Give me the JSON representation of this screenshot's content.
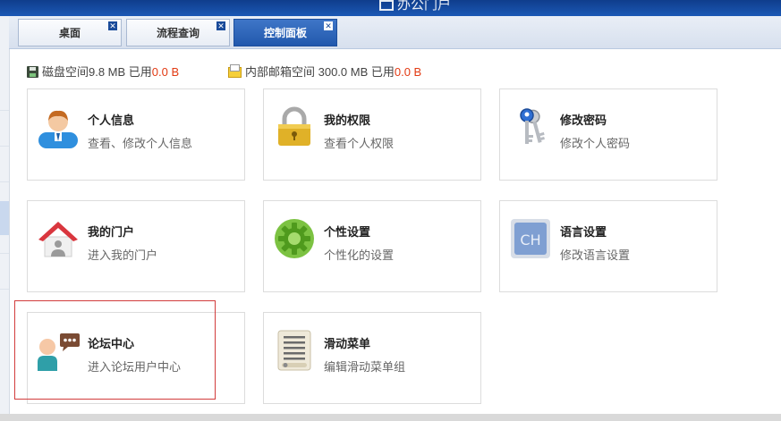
{
  "window": {
    "title": "办公门户"
  },
  "tabs": [
    {
      "label": "桌面",
      "close": "✕"
    },
    {
      "label": "流程查询",
      "close": "✕"
    },
    {
      "label": "控制面板",
      "close": "✕",
      "active": true
    }
  ],
  "status": {
    "disk_label": "磁盘空间9.8 MB 已用",
    "disk_used": "0.0 B",
    "mail_label": "内部邮箱空间 300.0 MB 已用",
    "mail_used": "0.0 B"
  },
  "cards": [
    {
      "title": "个人信息",
      "subtitle": "查看、修改个人信息",
      "icon": "person-icon"
    },
    {
      "title": "我的权限",
      "subtitle": "查看个人权限",
      "icon": "lock-icon"
    },
    {
      "title": "修改密码",
      "subtitle": "修改个人密码",
      "icon": "keys-icon"
    },
    {
      "title": "我的门户",
      "subtitle": "进入我的门户",
      "icon": "home-icon"
    },
    {
      "title": "个性设置",
      "subtitle": "个性化的设置",
      "icon": "gear-icon"
    },
    {
      "title": "语言设置",
      "subtitle": "修改语言设置",
      "icon": "language-icon",
      "icon_text": "CH"
    },
    {
      "title": "论坛中心",
      "subtitle": "进入论坛用户中心",
      "icon": "forum-icon"
    },
    {
      "title": "滑动菜单",
      "subtitle": "编辑滑动菜单组",
      "icon": "menu-list-icon"
    }
  ],
  "colors": {
    "tab_active": "#2158ad",
    "used_value": "#e23a13",
    "highlight": "#d23c3c"
  }
}
